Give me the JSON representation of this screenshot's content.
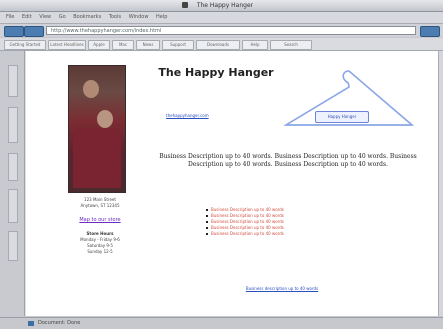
{
  "window": {
    "title": "The Happy Hanger"
  },
  "menubar": {
    "items": [
      "File",
      "Edit",
      "View",
      "Go",
      "Bookmarks",
      "Tools",
      "Window",
      "Help"
    ]
  },
  "address_bar": {
    "url": "http://www.thehappyhanger.com/index.html"
  },
  "bookmarks": [
    "Getting Started",
    "Latest Headlines",
    "Apple",
    "Mac",
    "News",
    "Support",
    "Downloads",
    "Help",
    "Search"
  ],
  "page": {
    "title": "The Happy Hanger",
    "link": "thehappyhanger.com",
    "hanger_label": "Happy Hanger",
    "description": "Business Description up to 40 words. Business Description up to 40 words. Business Description up to 40 words. Business Description up to 40 words.",
    "contact": {
      "address_line1": "123 Main Street",
      "address_line2": "Anytown, ST 12345",
      "map_link": "Map to our store",
      "hours_title": "Store Hours",
      "hours": [
        "Monday - Friday 9-6",
        "Saturday 9-5",
        "Sunday 12-5"
      ]
    },
    "list_items": [
      "Business Description up to 40 words",
      "Business Description up to 40 words",
      "Business Description up to 40 words",
      "Business Description up to 40 words",
      "Business Description up to 40 words"
    ],
    "footer_link": "Business description up to 40 words"
  },
  "status": {
    "text": "Document: Done"
  },
  "colors": {
    "window_bg": "#c7c9cf",
    "link_blue": "#2a4fbf",
    "list_red": "#d04a3c",
    "map_purple": "#6b2bc2"
  }
}
